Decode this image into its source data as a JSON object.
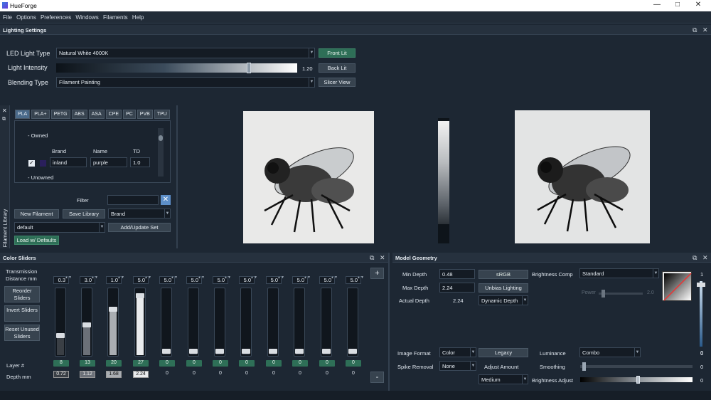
{
  "app": {
    "title": "HueForge",
    "minimize": "—",
    "maximize": "□",
    "close": "✕"
  },
  "menu": [
    "File",
    "Options",
    "Preferences",
    "Windows",
    "Filaments",
    "Help"
  ],
  "lighting": {
    "header": "Lighting Settings",
    "led_label": "LED Light Type",
    "led_value": "Natural White 4000K",
    "intensity_label": "Light Intensity",
    "intensity_value": "1.20",
    "intensity_level": 0.8,
    "blending_label": "Blending Type",
    "blending_value": "Filament Painting",
    "front_lit": "Front Lit",
    "back_lit": "Back Lit",
    "slicer_view": "Slicer View"
  },
  "library": {
    "side_label": "Filament Library",
    "tabs": [
      "PLA",
      "PLA+",
      "PETG",
      "ABS",
      "ASA",
      "CPE",
      "PC",
      "PVB",
      "TPU"
    ],
    "owned": "- Owned",
    "unowned": "- Unowned",
    "col_brand": "Brand",
    "col_name": "Name",
    "col_td": "TD",
    "row": {
      "brand": "inland",
      "name": "purple",
      "td": "1.0"
    },
    "filter_label": "Filter",
    "new_filament": "New Filament",
    "save_library": "Save Library",
    "sort_value": "Brand",
    "preset_value": "default",
    "add_update": "Add/Update Set",
    "load_defaults": "Load w/ Defaults"
  },
  "color_sliders": {
    "header": "Color Sliders",
    "trans_label": "Transmission Distance mm",
    "reorder": "Reorder Sliders",
    "invert": "Invert Sliders",
    "reset": "Reset Unused Sliders",
    "layer_label": "Layer #",
    "depth_label": "Depth mm",
    "plus": "+",
    "minus": "-",
    "sliders": [
      {
        "td": "0.3",
        "layer": "8",
        "depth": "0.72",
        "level": 0.28,
        "color": "#3a3f45",
        "boxed": true
      },
      {
        "td": "3.0",
        "layer": "13",
        "depth": "1.12",
        "level": 0.45,
        "color": "#6b7078",
        "boxed": true
      },
      {
        "td": "1.0",
        "layer": "20",
        "depth": "1.68",
        "level": 0.7,
        "color": "#a9adb2",
        "boxed": true
      },
      {
        "td": "5.0",
        "layer": "27",
        "depth": "2.24",
        "level": 0.92,
        "color": "#e9ebed",
        "boxed": true
      },
      {
        "td": "5.0",
        "layer": "0",
        "depth": "0",
        "level": 0.02,
        "color": "#1e2630",
        "boxed": false
      },
      {
        "td": "5.0",
        "layer": "0",
        "depth": "0",
        "level": 0.02,
        "color": "#1e2630",
        "boxed": false
      },
      {
        "td": "5.0",
        "layer": "0",
        "depth": "0",
        "level": 0.02,
        "color": "#1e2630",
        "boxed": false
      },
      {
        "td": "5.0",
        "layer": "0",
        "depth": "0",
        "level": 0.02,
        "color": "#1e2630",
        "boxed": false
      },
      {
        "td": "5.0",
        "layer": "0",
        "depth": "0",
        "level": 0.02,
        "color": "#1e2630",
        "boxed": false
      },
      {
        "td": "5.0",
        "layer": "0",
        "depth": "0",
        "level": 0.02,
        "color": "#1e2630",
        "boxed": false
      },
      {
        "td": "5.0",
        "layer": "0",
        "depth": "0",
        "level": 0.02,
        "color": "#1e2630",
        "boxed": false
      },
      {
        "td": "5.0",
        "layer": "0",
        "depth": "0",
        "level": 0.02,
        "color": "#1e2630",
        "boxed": false
      }
    ]
  },
  "geometry": {
    "header": "Model Geometry",
    "min_depth_label": "Min Depth",
    "min_depth": "0.48",
    "max_depth_label": "Max Depth",
    "max_depth": "2.24",
    "actual_depth_label": "Actual Depth",
    "actual_depth": "2.24",
    "srgb": "sRGB",
    "unbias": "Unbias Lighting",
    "dynamic_depth": "Dynamic Depth",
    "brightness_comp_label": "Brightness Comp",
    "brightness_comp": "Standard",
    "power_label": "Power",
    "power_value": "2.0",
    "vert_top": "1",
    "vert_bottom": "0",
    "image_format_label": "Image Format",
    "image_format": "Color",
    "legacy": "Legacy",
    "luminance_label": "Luminance",
    "luminance": "Combo",
    "luminance_value": "0",
    "spike_label": "Spike Removal",
    "spike": "None",
    "adjust_amount_label": "Adjust Amount",
    "smoothing_label": "Smoothing",
    "smoothing_value": "0",
    "smoothing_level": 0.02,
    "medium": "Medium",
    "brightness_adjust_label": "Brightness Adjust",
    "brightness_adjust_value": "0",
    "brightness_adjust_level": 0.5
  }
}
